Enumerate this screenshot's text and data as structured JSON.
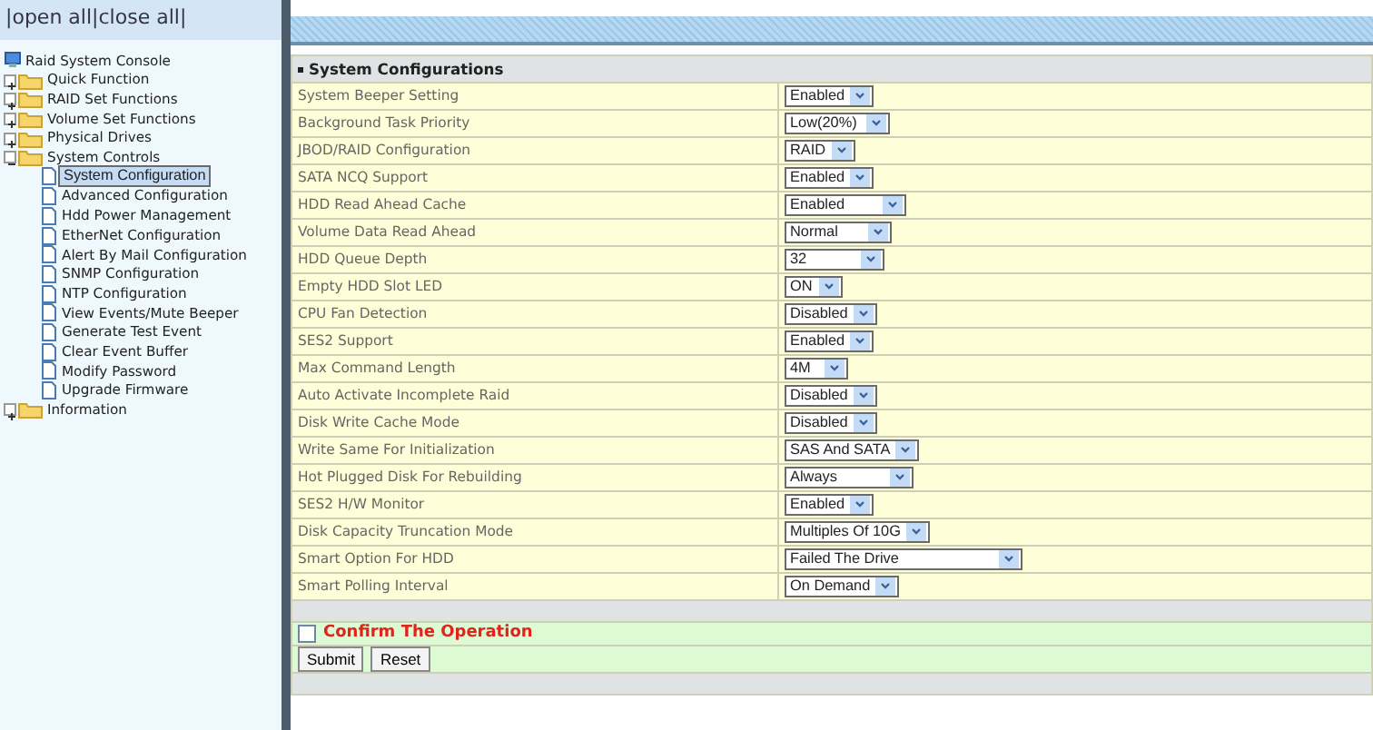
{
  "toolbar": {
    "separator": "|",
    "links": [
      "open all",
      "close all"
    ]
  },
  "tree": {
    "label": "Raid System Console",
    "children": [
      {
        "label": "Quick Function",
        "expanded": false
      },
      {
        "label": "RAID Set Functions",
        "expanded": false
      },
      {
        "label": "Volume Set Functions",
        "expanded": false
      },
      {
        "label": "Physical Drives",
        "expanded": false
      },
      {
        "label": "System Controls",
        "expanded": true,
        "children": [
          {
            "label": "System Configuration",
            "selected": true
          },
          {
            "label": "Advanced Configuration",
            "selected": false
          },
          {
            "label": "Hdd Power Management",
            "selected": false
          },
          {
            "label": "EtherNet Configuration",
            "selected": false
          },
          {
            "label": "Alert By Mail Configuration",
            "selected": false
          },
          {
            "label": "SNMP Configuration",
            "selected": false
          },
          {
            "label": "NTP Configuration",
            "selected": false
          },
          {
            "label": "View Events/Mute Beeper",
            "selected": false
          },
          {
            "label": "Generate Test Event",
            "selected": false
          },
          {
            "label": "Clear Event Buffer",
            "selected": false
          },
          {
            "label": "Modify Password",
            "selected": false
          },
          {
            "label": "Upgrade Firmware",
            "selected": false
          }
        ]
      },
      {
        "label": "Information",
        "expanded": false
      }
    ]
  },
  "panel": {
    "title": "System Configurations",
    "settings": [
      {
        "label": "System Beeper Setting",
        "value": "Enabled"
      },
      {
        "label": "Background Task Priority",
        "value": "Low(20%)"
      },
      {
        "label": "JBOD/RAID Configuration",
        "value": "RAID"
      },
      {
        "label": "SATA NCQ Support",
        "value": "Enabled"
      },
      {
        "label": "HDD Read Ahead Cache",
        "value": "Enabled"
      },
      {
        "label": "Volume Data Read Ahead",
        "value": "Normal"
      },
      {
        "label": "HDD Queue Depth",
        "value": "32"
      },
      {
        "label": "Empty HDD Slot LED",
        "value": "ON"
      },
      {
        "label": "CPU Fan Detection",
        "value": "Disabled"
      },
      {
        "label": "SES2 Support",
        "value": "Enabled"
      },
      {
        "label": "Max Command Length",
        "value": "4M"
      },
      {
        "label": "Auto Activate Incomplete Raid",
        "value": "Disabled"
      },
      {
        "label": "Disk Write Cache Mode",
        "value": "Disabled"
      },
      {
        "label": "Write Same For Initialization",
        "value": "SAS And SATA"
      },
      {
        "label": "Hot Plugged Disk For Rebuilding",
        "value": "Always"
      },
      {
        "label": "SES2 H/W Monitor",
        "value": "Enabled"
      },
      {
        "label": "Disk Capacity Truncation Mode",
        "value": "Multiples Of 10G"
      },
      {
        "label": "Smart Option For HDD",
        "value": "Failed The Drive"
      },
      {
        "label": "Smart Polling Interval",
        "value": "On Demand"
      }
    ],
    "confirm": {
      "label": "Confirm The Operation",
      "checked": false
    },
    "buttons": [
      "Submit",
      "Reset"
    ]
  }
}
